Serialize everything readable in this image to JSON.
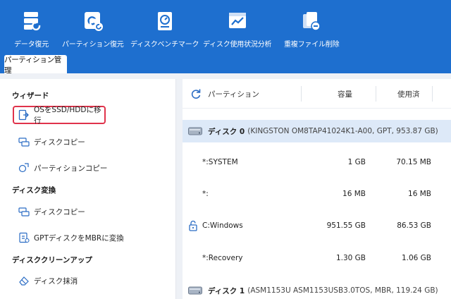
{
  "toolbar": {
    "items": [
      {
        "label": "データ復元",
        "icon": "data-recovery-icon"
      },
      {
        "label": "パーティション復元",
        "icon": "partition-recovery-icon"
      },
      {
        "label": "ディスクベンチマーク",
        "icon": "disk-benchmark-icon"
      },
      {
        "label": "ディスク使用状況分析",
        "icon": "disk-usage-analysis-icon"
      },
      {
        "label": "重複ファイル削除",
        "icon": "duplicate-file-delete-icon"
      }
    ]
  },
  "tab": {
    "label": "パーティション管理"
  },
  "sidebar": {
    "wizard_title": "ウィザード",
    "wizard_items": [
      {
        "label": "OSをSSD/HDDに移行",
        "icon": "migrate-os-icon"
      },
      {
        "label": "ディスクコピー",
        "icon": "disk-copy-icon"
      },
      {
        "label": "パーティションコピー",
        "icon": "partition-copy-icon"
      }
    ],
    "convert_title": "ディスク変換",
    "convert_items": [
      {
        "label": "ディスクコピー",
        "icon": "disk-copy-icon"
      },
      {
        "label": "GPTディスクをMBRに変換",
        "icon": "gpt-to-mbr-icon"
      }
    ],
    "cleanup_title": "ディスククリーンアップ",
    "cleanup_items": [
      {
        "label": "ディスク抹消",
        "icon": "eraser-icon"
      }
    ]
  },
  "table": {
    "headers": {
      "partition": "パーティション",
      "capacity": "容量",
      "used": "使用済"
    },
    "disks": [
      {
        "name": "ディスク 0",
        "info": "(KINGSTON OM8TAP41024K1-A00, GPT, 953.87 GB)"
      },
      {
        "name": "ディスク 1",
        "info": "(ASM1153U ASM1153USB3.0TOS, MBR, 119.24 GB)"
      }
    ],
    "partitions": [
      {
        "name": "*:SYSTEM",
        "capacity": "1 GB",
        "used": "70.15 MB",
        "locked": false
      },
      {
        "name": "*:",
        "capacity": "16 MB",
        "used": "16 MB",
        "locked": false
      },
      {
        "name": "C:Windows",
        "capacity": "951.55 GB",
        "used": "86.53 GB",
        "locked": true
      },
      {
        "name": "*:Recovery",
        "capacity": "1.30 GB",
        "used": "1.06 GB",
        "locked": false
      }
    ]
  },
  "colors": {
    "toolbar_bg": "#1e6fcf",
    "highlight_border": "#e0334b",
    "disk_row_bg": "#dde9f8"
  }
}
